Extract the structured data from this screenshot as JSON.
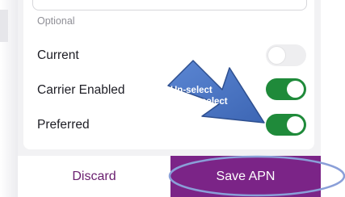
{
  "form": {
    "helper_text": "Optional",
    "rows": [
      {
        "label": "Current",
        "toggle_on": false
      },
      {
        "label": "Carrier Enabled",
        "toggle_on": true
      },
      {
        "label": "Preferred",
        "toggle_on": true
      }
    ]
  },
  "annotation": {
    "line1": "Un-select",
    "line2": "& Re-select",
    "arrow_color": "#4a74c0",
    "ellipse_color": "#8a9fd8"
  },
  "actions": {
    "discard_label": "Discard",
    "save_label": "Save APN"
  },
  "colors": {
    "accent": "#7b2487",
    "toggle_on": "#1f8a3a"
  }
}
